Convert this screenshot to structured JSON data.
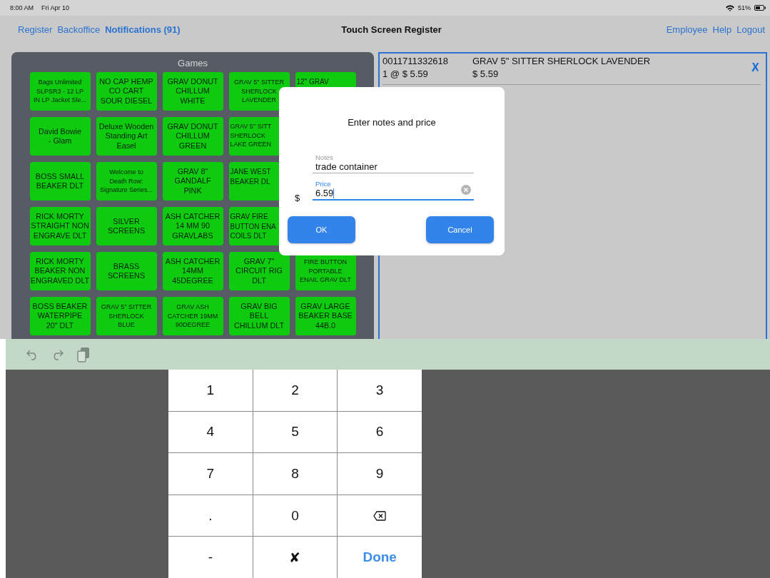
{
  "status_bar": {
    "time": "8:00 AM",
    "date": "Fri Apr 10",
    "battery": "51%"
  },
  "nav": {
    "left_links": [
      {
        "label": "Register",
        "emphasized": false
      },
      {
        "label": "Backoffice",
        "emphasized": false
      },
      {
        "label": "Notifications (91)",
        "emphasized": true
      }
    ],
    "title": "Touch Screen Register",
    "right_links": [
      {
        "label": "Employee"
      },
      {
        "label": "Help"
      },
      {
        "label": "Logout"
      }
    ]
  },
  "category_panel": {
    "title": "Games",
    "rows": [
      [
        {
          "lines": [
            "Bags Unlimited",
            "SLPSR3 - 12 LP",
            "IN LP Jacket Sle..."
          ],
          "small": true
        },
        {
          "lines": [
            "NO CAP HEMP",
            "CO CART",
            "SOUR DIESEL"
          ],
          "small": false
        },
        {
          "lines": [
            "GRAV DONUT",
            "CHILLUM",
            "WHITE"
          ],
          "small": false
        },
        {
          "lines": [
            "GRAV 5\" SITTER",
            "SHERLOCK",
            "LAVENDER"
          ],
          "small": true,
          "partly_hidden": false
        },
        {
          "lines": [
            "12\" GRAV"
          ],
          "small": false,
          "partly_hidden": true
        }
      ],
      [
        {
          "lines": [
            "David Bowie",
            "- Glam"
          ],
          "small": false
        },
        {
          "lines": [
            "Deluxe Wooden",
            "Standing Art",
            "Easel"
          ],
          "small": false
        },
        {
          "lines": [
            "GRAV DONUT",
            "CHILLUM",
            "GREEN"
          ],
          "small": false
        },
        {
          "lines": [
            "GRAV 5'' SITT",
            "SHERLOCK",
            "LAKE GREEN"
          ],
          "small": true,
          "partly_hidden": true
        }
      ],
      [
        {
          "lines": [
            "BOSS SMALL",
            "BEAKER DLT"
          ],
          "small": false
        },
        {
          "lines": [
            "Welcome to",
            "Death Row:",
            "Signature Series..."
          ],
          "small": true
        },
        {
          "lines": [
            "GRAV 8\"",
            "GANDALF",
            "PINK"
          ],
          "small": false
        },
        {
          "lines": [
            "JANE WEST",
            "BEAKER DL"
          ],
          "small": false,
          "partly_hidden": true
        }
      ],
      [
        {
          "lines": [
            "RICK MORTY",
            "STRAIGHT NON",
            "ENGRAVE DLT"
          ],
          "small": false
        },
        {
          "lines": [
            "SILVER",
            "SCREENS"
          ],
          "small": false
        },
        {
          "lines": [
            "ASH CATCHER",
            "14 MM 90",
            "GRAVLABS"
          ],
          "small": false
        },
        {
          "lines": [
            "GRAV FIRE",
            "BUTTON ENA",
            "COILS DLT"
          ],
          "small": false,
          "partly_hidden": true
        }
      ],
      [
        {
          "lines": [
            "RICK MORTY",
            "BEAKER NON",
            "ENGRAVED DLT"
          ],
          "small": false
        },
        {
          "lines": [
            "BRASS",
            "SCREENS"
          ],
          "small": false
        },
        {
          "lines": [
            "ASH CATCHER",
            "14MM",
            "45DEGREE"
          ],
          "small": false
        },
        {
          "lines": [
            "GRAV 7\"",
            "CIRCUIT RIG",
            "DLT"
          ],
          "small": false
        },
        {
          "lines": [
            "FIRE BUTTON",
            "PORTABLE",
            "ENAIL GRAV DLT"
          ],
          "small": true
        }
      ],
      [
        {
          "lines": [
            "BOSS BEAKER",
            "WATERPIPE",
            "20\" DLT"
          ],
          "small": false
        },
        {
          "lines": [
            "GRAV 5'' SITTER",
            "SHERLOCK",
            "BLUE"
          ],
          "small": true
        },
        {
          "lines": [
            "GRAV ASH",
            "CATCHER 19MM",
            "90DEGREE"
          ],
          "small": true
        },
        {
          "lines": [
            "GRAV BIG",
            "BELL",
            "CHILLUM DLT"
          ],
          "small": false
        },
        {
          "lines": [
            "GRAV LARGE",
            "BEAKER BASE",
            "44B.0"
          ],
          "small": false
        }
      ]
    ]
  },
  "cart": {
    "items": [
      {
        "code": "0011711332618",
        "name": "GRAV 5\" SITTER SHERLOCK LAVENDER",
        "quantity_price": "1 @ $ 5.59",
        "total": "$ 5.59"
      }
    ]
  },
  "dialog": {
    "title": "Enter notes and price",
    "notes": {
      "label": "Notes",
      "value": "trade container",
      "focused": false
    },
    "price": {
      "prefix": "$",
      "label": "Price",
      "value": "6.59",
      "focused": true
    },
    "buttons": [
      {
        "label": "OK"
      },
      {
        "label": "Cancel"
      }
    ]
  },
  "keypad": {
    "keys": [
      {
        "kind": "text",
        "label": "1"
      },
      {
        "kind": "text",
        "label": "2"
      },
      {
        "kind": "text",
        "label": "3"
      },
      {
        "kind": "text",
        "label": "4"
      },
      {
        "kind": "text",
        "label": "5"
      },
      {
        "kind": "text",
        "label": "6"
      },
      {
        "kind": "text",
        "label": "7"
      },
      {
        "kind": "text",
        "label": "8"
      },
      {
        "kind": "text",
        "label": "9"
      },
      {
        "kind": "text",
        "label": "."
      },
      {
        "kind": "text",
        "label": "0"
      },
      {
        "kind": "backspace"
      },
      {
        "kind": "text",
        "label": "-"
      },
      {
        "kind": "text",
        "label": "✘"
      },
      {
        "kind": "done",
        "label": "Done"
      }
    ]
  }
}
